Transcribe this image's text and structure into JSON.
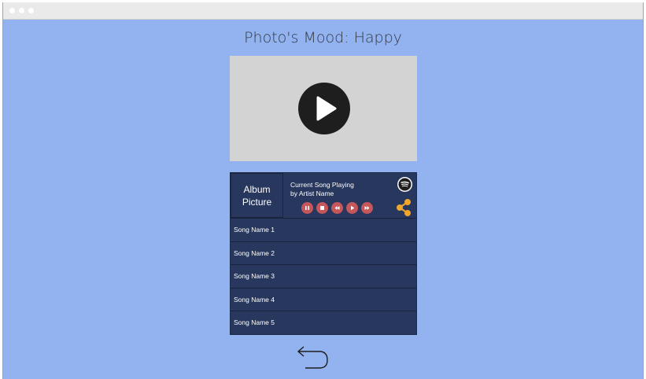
{
  "page": {
    "title": "Photo's Mood: Happy"
  },
  "video": {
    "play_icon": "play-icon"
  },
  "player": {
    "album_label": "Album Picture",
    "now_playing_line1": "Current Song Playing",
    "now_playing_line2": "by Artist Name",
    "brand_icon": "spotify-icon",
    "controls": [
      "pause-icon",
      "stop-icon",
      "rewind-icon",
      "play-icon",
      "fast-forward-icon"
    ],
    "share_icon": "share-icon"
  },
  "songs": [
    "Song Name 1",
    "Song Name 2",
    "Song Name 3",
    "Song Name 4",
    "Song Name 5"
  ],
  "footer": {
    "back_icon": "back-arrow-icon"
  },
  "colors": {
    "background": "#93b3f0",
    "panel": "#27375d",
    "control": "#c5565a",
    "share": "#f0a62c",
    "video_placeholder": "#d3d3d3"
  }
}
